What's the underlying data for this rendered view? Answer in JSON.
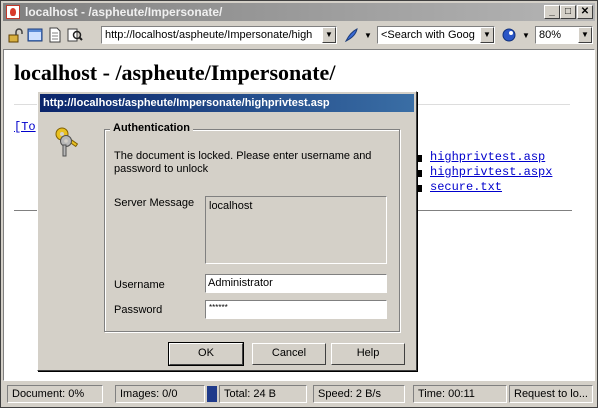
{
  "window": {
    "title": "localhost - /aspheute/Impersonate/"
  },
  "toolbar": {
    "address": "http://localhost/aspheute/Impersonate/high",
    "search_placeholder": "<Search with Goog",
    "zoom": "80%"
  },
  "page": {
    "heading": "localhost - /aspheute/Impersonate/",
    "partial_link": "[To",
    "files": [
      "highprivtest.asp",
      "highprivtest.aspx",
      "secure.txt"
    ]
  },
  "dialog": {
    "title": "http://localhost/aspheute/Impersonate/highprivtest.asp",
    "group_label": "Authentication",
    "message": "The document is locked. Please enter username and password to unlock",
    "server_message_label": "Server Message",
    "server_message": "localhost",
    "username_label": "Username",
    "username_value": "Administrator",
    "password_label": "Password",
    "password_mask": "******",
    "ok": "OK",
    "cancel": "Cancel",
    "help": "Help"
  },
  "status": {
    "document": "Document:   0%",
    "images": "Images:    0/0",
    "total": "Total:   24 B",
    "speed": "Speed:   2 B/s",
    "time": "Time:    00:11",
    "request": "Request to lo..."
  }
}
